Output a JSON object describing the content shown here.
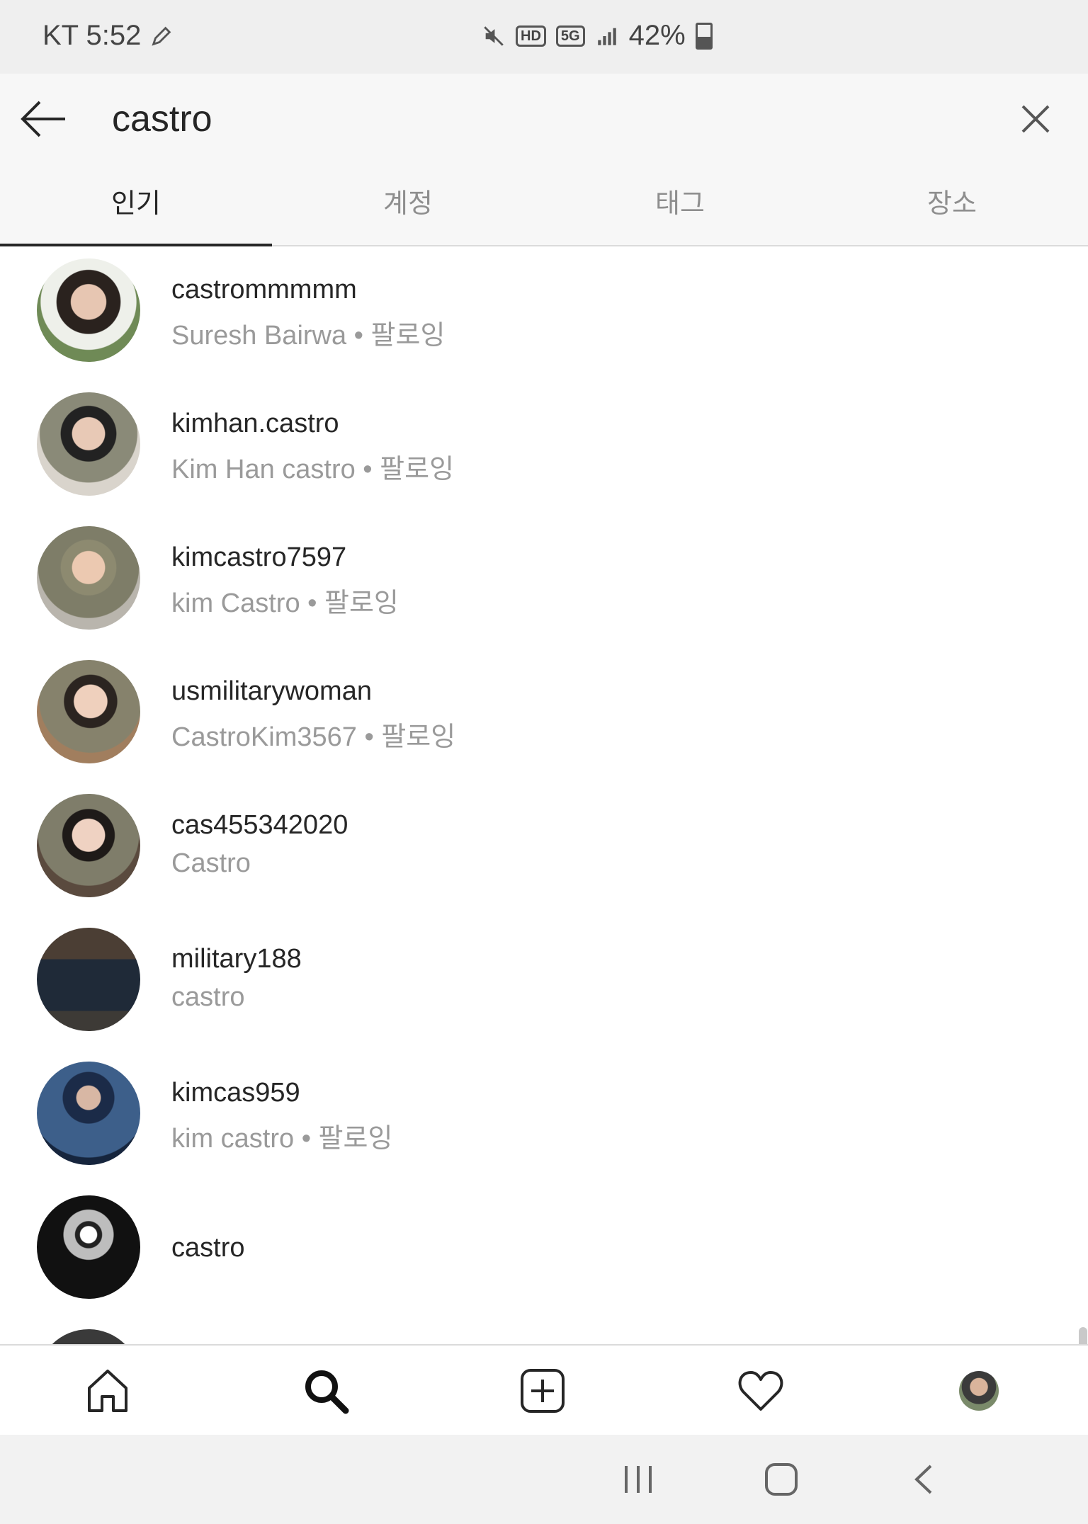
{
  "status_bar": {
    "carrier_time": "KT 5:52",
    "network_badge_hd": "HD",
    "network_badge_5g": "5G",
    "battery": "42%"
  },
  "search": {
    "query": "castro",
    "back_icon": "arrow-left-icon",
    "clear_icon": "close-icon"
  },
  "tabs": [
    {
      "label": "인기",
      "active": true
    },
    {
      "label": "계정",
      "active": false
    },
    {
      "label": "태그",
      "active": false
    },
    {
      "label": "장소",
      "active": false
    }
  ],
  "results": [
    {
      "username": "castrommmmm",
      "subtitle": "Suresh Bairwa • 팔로잉"
    },
    {
      "username": "kimhan.castro",
      "subtitle": "Kim Han castro • 팔로잉"
    },
    {
      "username": "kimcastro7597",
      "subtitle": "kim Castro • 팔로잉"
    },
    {
      "username": "usmilitarywoman",
      "subtitle": "CastroKim3567 • 팔로잉"
    },
    {
      "username": "cas455342020",
      "subtitle": "Castro"
    },
    {
      "username": "military188",
      "subtitle": "castro"
    },
    {
      "username": "kimcas959",
      "subtitle": "kim castro • 팔로잉"
    },
    {
      "username": "castro",
      "subtitle": ""
    }
  ],
  "bottom_nav": {
    "icons": [
      "home-icon",
      "search-icon",
      "add-post-icon",
      "heart-icon",
      "profile-avatar"
    ]
  },
  "system_nav": {
    "icons": [
      "recent-apps-icon",
      "home-button-icon",
      "back-chevron-icon"
    ]
  }
}
